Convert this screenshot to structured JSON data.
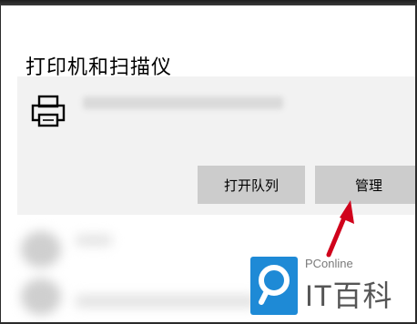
{
  "printers_scanners": {
    "title": "打印机和扫描仪",
    "printer": {
      "icon": "printer-icon",
      "open_queue_label": "打开队列",
      "manage_label": "管理"
    }
  },
  "annotation": {
    "arrow_color": "#d0021b"
  },
  "watermark": {
    "brand_small": "PConline",
    "brand_big": "IT百科",
    "logo_color": "#1e8ad6"
  }
}
